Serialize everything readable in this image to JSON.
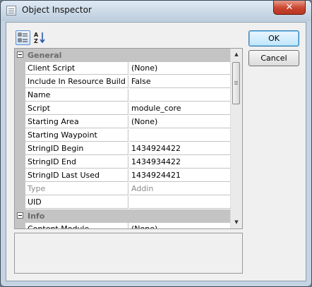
{
  "window": {
    "title": "Object Inspector",
    "close_glyph": "✕",
    "icon": "window-icon"
  },
  "toolbar": {
    "categorized_icon": "categorized-view-icon",
    "alphabetical_icon": "sort-alphabetical-icon"
  },
  "buttons": {
    "ok": "OK",
    "cancel": "Cancel"
  },
  "categories": [
    {
      "name": "General",
      "expanded": true,
      "properties": [
        {
          "name": "Client Script",
          "value": "(None)",
          "readonly": false
        },
        {
          "name": "Include In Resource Build",
          "value": "False",
          "readonly": false
        },
        {
          "name": "Name",
          "value": "",
          "readonly": false
        },
        {
          "name": "Script",
          "value": "module_core",
          "readonly": false
        },
        {
          "name": "Starting Area",
          "value": "(None)",
          "readonly": false
        },
        {
          "name": "Starting Waypoint",
          "value": "",
          "readonly": false
        },
        {
          "name": "StringID Begin",
          "value": "1434924422",
          "readonly": false
        },
        {
          "name": "StringID End",
          "value": "1434934422",
          "readonly": false
        },
        {
          "name": "StringID Last Used",
          "value": "1434924421",
          "readonly": false
        },
        {
          "name": "Type",
          "value": "Addin",
          "readonly": true
        },
        {
          "name": "UID",
          "value": "",
          "readonly": false
        }
      ]
    },
    {
      "name": "Info",
      "expanded": true,
      "properties": [
        {
          "name": "Content Module",
          "value": "(None)",
          "readonly": false
        }
      ]
    }
  ],
  "scrollbar": {
    "up_glyph": "▲",
    "down_glyph": "▼"
  },
  "description": ""
}
